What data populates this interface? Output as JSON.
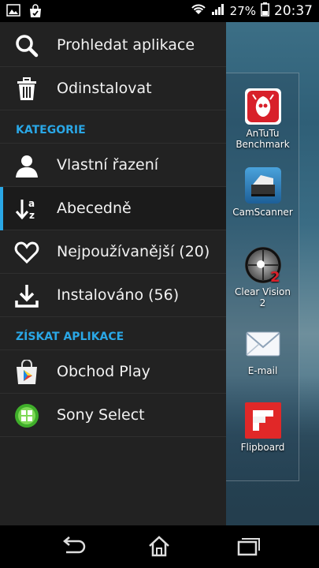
{
  "status_bar": {
    "battery_percent": "27%",
    "time": "20:37"
  },
  "menu": {
    "search_label": "Prohledat aplikace",
    "uninstall_label": "Odinstalovat",
    "categories_header": "KATEGORIE",
    "categories": [
      {
        "label": "Vlastní řazení",
        "icon": "person-icon",
        "selected": false
      },
      {
        "label": "Abecedně",
        "icon": "sort-alphabetical-icon",
        "selected": true
      },
      {
        "label": "Nejpoužívanější (20)",
        "icon": "heart-icon",
        "selected": false
      },
      {
        "label": "Instalováno (56)",
        "icon": "download-icon",
        "selected": false
      }
    ],
    "get_apps_header": "ZÍSKAT APLIKACE",
    "stores": [
      {
        "label": "Obchod Play",
        "icon": "play-store-icon"
      },
      {
        "label": "Sony Select",
        "icon": "sony-select-icon"
      }
    ]
  },
  "apps": [
    {
      "line1": "AnTuTu",
      "line2": "Benchmark",
      "icon": "antutu-icon"
    },
    {
      "line1": "CamScanner",
      "line2": "",
      "icon": "camscanner-icon"
    },
    {
      "line1": "Clear Vision",
      "line2": "2",
      "icon": "clear-vision-icon"
    },
    {
      "line1": "E-mail",
      "line2": "",
      "icon": "email-icon"
    },
    {
      "line1": "Flipboard",
      "line2": "",
      "icon": "flipboard-icon"
    }
  ],
  "colors": {
    "accent": "#2aa7e6",
    "drawer_bg": "#222222"
  }
}
